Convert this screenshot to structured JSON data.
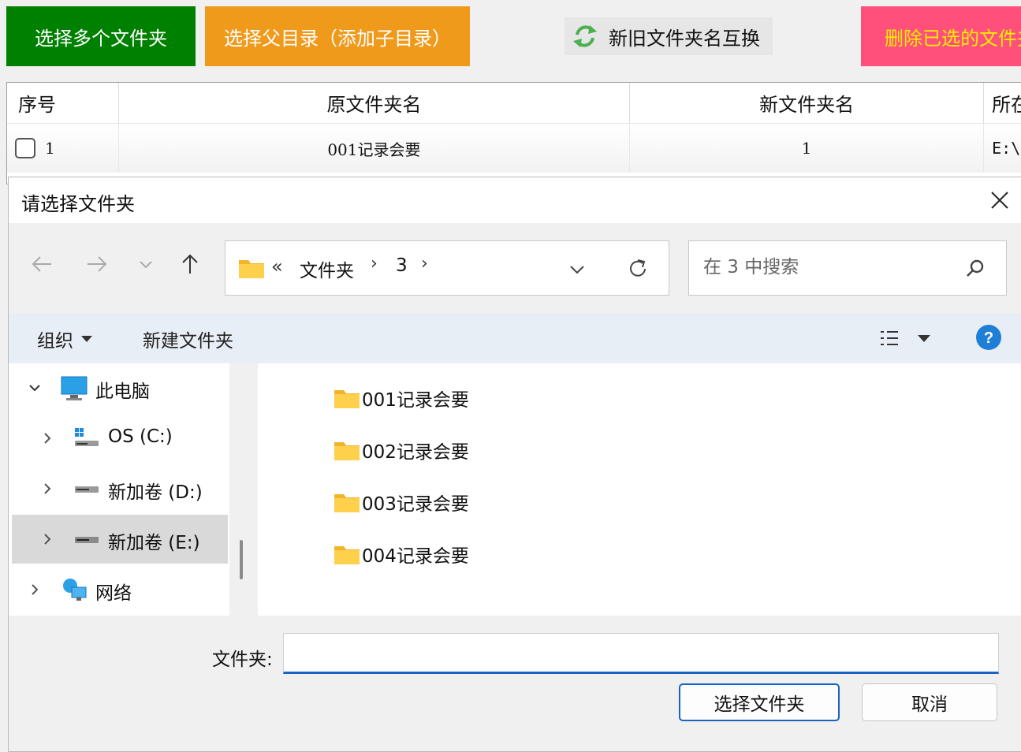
{
  "toolbar": {
    "select_multiple": "选择多个文件夹",
    "select_parent": "选择父目录（添加子目录）",
    "swap_names": "新旧文件夹名互换",
    "delete_selected": "删除已选的文件夹"
  },
  "grid": {
    "columns": [
      "序号",
      "原文件夹名",
      "新文件夹名",
      "所在"
    ],
    "rows": [
      {
        "index": "1",
        "old_name": "001记录会要",
        "new_name": "1",
        "path": "E:\\"
      }
    ]
  },
  "dialog": {
    "title": "请选择文件夹",
    "address": {
      "overflow": "«",
      "segments": [
        "文件夹",
        "3"
      ],
      "separator": "›"
    },
    "search_placeholder": "在 3 中搜索",
    "commands": {
      "organize": "组织",
      "new_folder": "新建文件夹"
    },
    "tree": [
      {
        "label": "此电脑",
        "icon": "computer-icon",
        "expanded": true
      },
      {
        "label": "OS (C:)",
        "icon": "windows-drive-icon"
      },
      {
        "label": "新加卷 (D:)",
        "icon": "drive-icon"
      },
      {
        "label": "新加卷 (E:)",
        "icon": "drive-icon",
        "selected": true
      },
      {
        "label": "网络",
        "icon": "network-icon"
      }
    ],
    "files": [
      "001记录会要",
      "002记录会要",
      "003记录会要",
      "004记录会要"
    ],
    "footer": {
      "folder_label": "文件夹:",
      "folder_value": "",
      "ok": "选择文件夹",
      "cancel": "取消"
    }
  },
  "colors": {
    "select_multiple_bg": "#008000",
    "select_parent_bg": "#f09a1c",
    "delete_bg": "#ff4f7b",
    "delete_text": "#ffee00",
    "accent": "#1a63c2"
  }
}
